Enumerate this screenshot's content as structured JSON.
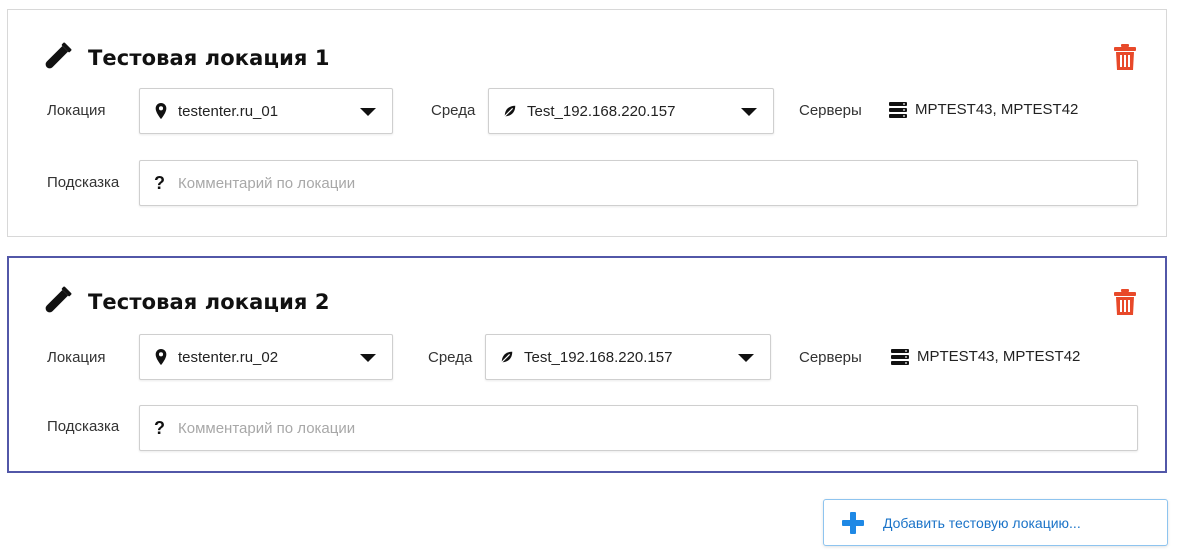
{
  "locations": [
    {
      "title": "Тестовая локация 1",
      "location_label": "Локация",
      "location_value": "testenter.ru_01",
      "env_label": "Среда",
      "env_value": "Test_192.168.220.157",
      "servers_label": "Серверы",
      "servers_value": "MPTEST43, MPTEST42",
      "hint_label": "Подсказка",
      "hint_placeholder": "Комментарий по локации",
      "hint_value": ""
    },
    {
      "title": "Тестовая локация 2",
      "location_label": "Локация",
      "location_value": "testenter.ru_02",
      "env_label": "Среда",
      "env_value": "Test_192.168.220.157",
      "servers_label": "Серверы",
      "servers_value": "MPTEST43, MPTEST42",
      "hint_label": "Подсказка",
      "hint_placeholder": "Комментарий по локации",
      "hint_value": ""
    }
  ],
  "add_button_label": "Добавить тестовую локацию...",
  "icons": {
    "title": "test-tube-icon",
    "delete": "trash-icon",
    "location": "map-marker-icon",
    "env": "leaf-icon",
    "servers": "server-icon",
    "hint": "question-icon",
    "add": "plus-icon"
  },
  "colors": {
    "delete": "#e8492a",
    "active_border": "#5257a8",
    "add_accent": "#1e88e5"
  }
}
